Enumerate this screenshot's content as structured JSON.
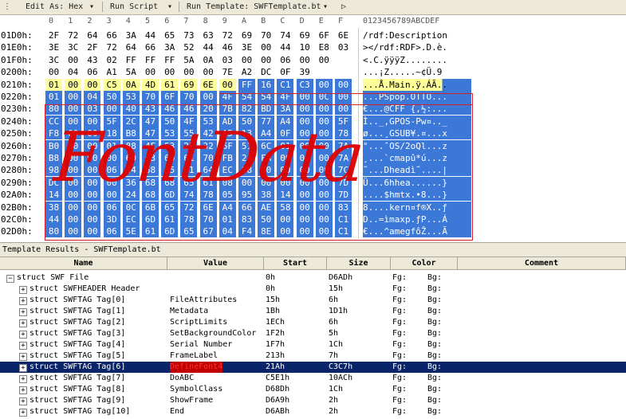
{
  "toolbar": {
    "edit_as": "Edit As: Hex",
    "run_script": "Run Script",
    "run_template": "Run Template: SWFTemplate.bt"
  },
  "hex_header": {
    "columns": [
      "0",
      "1",
      "2",
      "3",
      "4",
      "5",
      "6",
      "7",
      "8",
      "9",
      "A",
      "B",
      "C",
      "D",
      "E",
      "F"
    ],
    "ascii_ruler": "0123456789ABCDEF"
  },
  "hex_rows": [
    {
      "addr": "01D0h:",
      "bytes": [
        "2F",
        "72",
        "64",
        "66",
        "3A",
        "44",
        "65",
        "73",
        "63",
        "72",
        "69",
        "70",
        "74",
        "69",
        "6F",
        "6E"
      ],
      "ascii": "/rdf:Description"
    },
    {
      "addr": "01E0h:",
      "bytes": [
        "3E",
        "3C",
        "2F",
        "72",
        "64",
        "66",
        "3A",
        "52",
        "44",
        "46",
        "3E",
        "00",
        "44",
        "10",
        "E8",
        "03"
      ],
      "ascii": "></rdf:RDF>.D.è."
    },
    {
      "addr": "01F0h:",
      "bytes": [
        "3C",
        "00",
        "43",
        "02",
        "FF",
        "FF",
        "FF",
        "5A",
        "0A",
        "03",
        "00",
        "00",
        "06",
        "00",
        "00",
        ""
      ],
      "ascii": "<.C.ÿÿÿZ........"
    },
    {
      "addr": "0200h:",
      "bytes": [
        "00",
        "04",
        "06",
        "A1",
        "5A",
        "00",
        "00",
        "00",
        "00",
        "7E",
        "A2",
        "DC",
        "0F",
        "39",
        "",
        ""
      ],
      "ascii": "...¡Z.....~¢Ü.9"
    },
    {
      "addr": "0210h:",
      "bytes": [
        "01",
        "00",
        "00",
        "C5",
        "0A",
        "4D",
        "61",
        "69",
        "6E",
        "00",
        "FF",
        "16",
        "C1",
        "C3",
        "00",
        "00"
      ],
      "ascii": "...Å.Main.ÿ.ÁÃ.."
    },
    {
      "addr": "0220h:",
      "bytes": [
        "01",
        "00",
        "04",
        "50",
        "53",
        "70",
        "6F",
        "70",
        "00",
        "4F",
        "54",
        "54",
        "4F",
        "00",
        "0C",
        "00"
      ],
      "ascii": "...PSpop.OTTO..."
    },
    {
      "addr": "0230h:",
      "bytes": [
        "80",
        "00",
        "03",
        "00",
        "40",
        "43",
        "46",
        "46",
        "20",
        "7B",
        "82",
        "BD",
        "3A",
        "00",
        "00",
        "00"
      ],
      "ascii": "€...@CFF {‚½:..."
    },
    {
      "addr": "0240h:",
      "bytes": [
        "CC",
        "00",
        "00",
        "5F",
        "2C",
        "47",
        "50",
        "4F",
        "53",
        "AD",
        "50",
        "77",
        "A4",
        "00",
        "00",
        "5F"
      ],
      "ascii": "Ì.._,GPOS-Pw¤.._"
    },
    {
      "addr": "0250h:",
      "bytes": [
        "F8",
        "00",
        "00",
        "18",
        "B8",
        "47",
        "53",
        "55",
        "42",
        "A5",
        "13",
        "A4",
        "0F",
        "00",
        "00",
        "78"
      ],
      "ascii": "ø...¸GSUB¥.¤...x"
    },
    {
      "addr": "0260h:",
      "bytes": [
        "B0",
        "00",
        "00",
        "01",
        "88",
        "4F",
        "53",
        "2F",
        "32",
        "6F",
        "51",
        "6C",
        "01",
        "00",
        "00",
        "7A"
      ],
      "ascii": "°...ˆOS/2oQl...z"
    },
    {
      "addr": "0270h:",
      "bytes": [
        "B8",
        "00",
        "00",
        "00",
        "60",
        "63",
        "6D",
        "61",
        "70",
        "FB",
        "2A",
        "FA",
        "00",
        "00",
        "00",
        "7A"
      ],
      "ascii": "¸...`cmapû*ú...z"
    },
    {
      "addr": "0280h:",
      "bytes": [
        "98",
        "00",
        "00",
        "06",
        "44",
        "68",
        "65",
        "61",
        "64",
        "EC",
        "98",
        "00",
        "00",
        "00",
        "00",
        "7C"
      ],
      "ascii": "˜...Dheadì˜....|"
    },
    {
      "addr": "0290h:",
      "bytes": [
        "DC",
        "00",
        "00",
        "00",
        "36",
        "68",
        "68",
        "65",
        "61",
        "08",
        "00",
        "00",
        "00",
        "00",
        "00",
        "7D"
      ],
      "ascii": "Ü...6hhea......}"
    },
    {
      "addr": "02A0h:",
      "bytes": [
        "14",
        "00",
        "00",
        "00",
        "24",
        "68",
        "6D",
        "74",
        "78",
        "05",
        "95",
        "38",
        "14",
        "00",
        "00",
        "7D"
      ],
      "ascii": "....$hmtx.•8...}"
    },
    {
      "addr": "02B0h:",
      "bytes": [
        "38",
        "00",
        "00",
        "06",
        "0C",
        "6B",
        "65",
        "72",
        "6E",
        "A4",
        "66",
        "AE",
        "58",
        "00",
        "00",
        "83"
      ],
      "ascii": "8....kern¤f®X..ƒ"
    },
    {
      "addr": "02C0h:",
      "bytes": [
        "44",
        "00",
        "00",
        "3D",
        "EC",
        "6D",
        "61",
        "78",
        "70",
        "01",
        "83",
        "50",
        "00",
        "00",
        "00",
        "C1"
      ],
      "ascii": "D..=ìmaxp.ƒP...Á"
    },
    {
      "addr": "02D0h:",
      "bytes": [
        "80",
        "00",
        "00",
        "06",
        "5E",
        "61",
        "6D",
        "65",
        "67",
        "04",
        "F4",
        "8E",
        "00",
        "00",
        "00",
        "C1"
      ],
      "ascii": "€...^amegfôŽ...Ã"
    }
  ],
  "annotation_text": "FontData",
  "template_panel": {
    "title": "Template Results - SWFTemplate.bt",
    "columns": [
      "Name",
      "Value",
      "Start",
      "Size",
      "Color",
      "Comment"
    ],
    "rows": [
      {
        "exp": "−",
        "name": "struct SWF File",
        "value": "",
        "start": "0h",
        "size": "D6ADh",
        "fg": "Fg:",
        "bg": "Bg:"
      },
      {
        "exp": "+",
        "name": "struct SWFHEADER Header",
        "value": "",
        "start": "0h",
        "size": "15h",
        "fg": "Fg:",
        "bg": "Bg:"
      },
      {
        "exp": "+",
        "name": "struct SWFTAG Tag[0]",
        "value": "FileAttributes",
        "start": "15h",
        "size": "6h",
        "fg": "Fg:",
        "bg": "Bg:"
      },
      {
        "exp": "+",
        "name": "struct SWFTAG Tag[1]",
        "value": "Metadata",
        "start": "1Bh",
        "size": "1D1h",
        "fg": "Fg:",
        "bg": "Bg:"
      },
      {
        "exp": "+",
        "name": "struct SWFTAG Tag[2]",
        "value": "ScriptLimits",
        "start": "1ECh",
        "size": "6h",
        "fg": "Fg:",
        "bg": "Bg:"
      },
      {
        "exp": "+",
        "name": "struct SWFTAG Tag[3]",
        "value": "SetBackgroundColor",
        "start": "1F2h",
        "size": "5h",
        "fg": "Fg:",
        "bg": "Bg:"
      },
      {
        "exp": "+",
        "name": "struct SWFTAG Tag[4]",
        "value": "Serial Number",
        "start": "1F7h",
        "size": "1Ch",
        "fg": "Fg:",
        "bg": "Bg:"
      },
      {
        "exp": "+",
        "name": "struct SWFTAG Tag[5]",
        "value": "FrameLabel",
        "start": "213h",
        "size": "7h",
        "fg": "Fg:",
        "bg": "Bg:"
      },
      {
        "exp": "+",
        "name": "struct SWFTAG Tag[6]",
        "value": "DefineFont4",
        "start": "21Ah",
        "size": "C3C7h",
        "fg": "Fg:",
        "bg": "Bg:"
      },
      {
        "exp": "+",
        "name": "struct SWFTAG Tag[7]",
        "value": "DoABC",
        "start": "C5E1h",
        "size": "10ACh",
        "fg": "Fg:",
        "bg": "Bg:"
      },
      {
        "exp": "+",
        "name": "struct SWFTAG Tag[8]",
        "value": "SymbolClass",
        "start": "D68Dh",
        "size": "1Ch",
        "fg": "Fg:",
        "bg": "Bg:"
      },
      {
        "exp": "+",
        "name": "struct SWFTAG Tag[9]",
        "value": "ShowFrame",
        "start": "D6A9h",
        "size": "2h",
        "fg": "Fg:",
        "bg": "Bg:"
      },
      {
        "exp": "+",
        "name": "struct SWFTAG Tag[10]",
        "value": "End",
        "start": "D6ABh",
        "size": "2h",
        "fg": "Fg:",
        "bg": "Bg:"
      }
    ]
  },
  "colors": {
    "selection": "#3c78d8",
    "highlight_yellow": "#ffff99",
    "annotation_red": "#e00000",
    "selected_row": "#0a246a"
  }
}
